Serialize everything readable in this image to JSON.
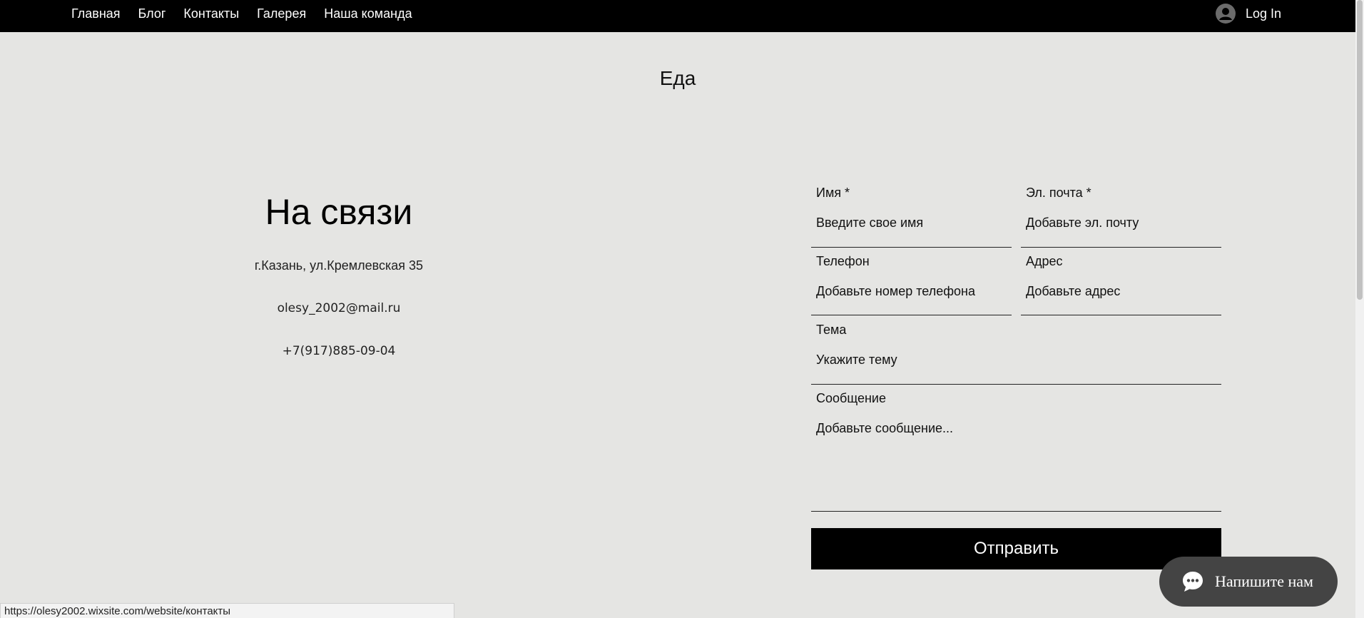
{
  "nav": {
    "items": [
      {
        "label": "Главная"
      },
      {
        "label": "Блог"
      },
      {
        "label": "Контакты"
      },
      {
        "label": "Галерея"
      },
      {
        "label": "Наша команда"
      }
    ],
    "login_label": "Log In",
    "login_icon": "user-avatar-icon"
  },
  "site": {
    "title": "Еда"
  },
  "contact": {
    "heading": "На связи",
    "address": "г.Казань, ул.Кремлевская 35",
    "email": "olesy_2002@mail.ru",
    "phone": "+7(917)885-09-04"
  },
  "form": {
    "name": {
      "label": "Имя *",
      "placeholder": "Введите свое имя"
    },
    "email": {
      "label": "Эл. почта *",
      "placeholder": "Добавьте эл. почту"
    },
    "phone": {
      "label": "Телефон",
      "placeholder": "Добавьте номер телефона"
    },
    "address": {
      "label": "Адрес",
      "placeholder": "Добавьте адрес"
    },
    "subject": {
      "label": "Тема",
      "placeholder": "Укажите тему"
    },
    "message": {
      "label": "Сообщение",
      "placeholder": "Добавьте сообщение..."
    },
    "submit_label": "Отправить"
  },
  "chat": {
    "label": "Напишите нам",
    "icon": "chat-bubble-icon"
  },
  "statusbar": {
    "url": "https://olesy2002.wixsite.com/website/контакты"
  },
  "colors": {
    "nav_bg": "#000000",
    "page_bg": "#e5e5e3",
    "button_bg": "#000000",
    "chat_bg": "#444444"
  }
}
